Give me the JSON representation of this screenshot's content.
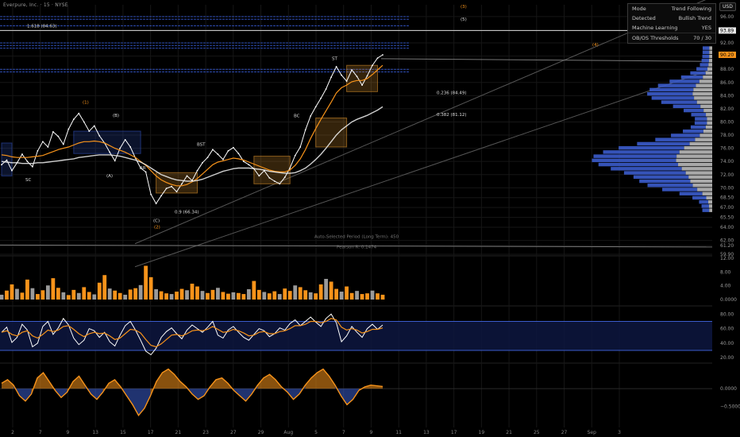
{
  "header": {
    "title": "Everpure, Inc. · 15 · NYSE",
    "currency": "USD"
  },
  "info_table": [
    {
      "label": "Mode",
      "value": "Trend Following"
    },
    {
      "label": "Detected",
      "value": "Bullish Trend"
    },
    {
      "label": "Machine Learning",
      "value": "YES"
    },
    {
      "label": "OB/OS Thresholds",
      "value": "70 / 30"
    }
  ],
  "colors": {
    "background": "#000000",
    "price": "#ffffff",
    "orange": "#f7931a",
    "blue": "#3b5ccc",
    "grid": "#161616",
    "label_current": "#f7931a"
  },
  "chart_data": [
    {
      "type": "line",
      "panel": "price",
      "ylim": [
        59.9,
        97.8
      ],
      "y_ticks": [
        96.0,
        93.89,
        92.0,
        90.0,
        88.0,
        86.0,
        84.0,
        82.0,
        80.0,
        78.0,
        76.0,
        74.0,
        72.0,
        70.0,
        68.5,
        67.0,
        65.5,
        64.0,
        62.0,
        61.2,
        59.9
      ],
      "y_tick_labels": [
        "96.00",
        "93.89",
        "92.00",
        "90.00",
        "88.00",
        "86.00",
        "84.00",
        "82.00",
        "80.00",
        "78.00",
        "76.00",
        "74.00",
        "72.00",
        "70.00",
        "68.50",
        "67.00",
        "65.50",
        "64.00",
        "62.00",
        "61.20",
        "59.90"
      ],
      "current_price_label": "90.20",
      "highlight_label": "93.89",
      "x_ticks": [
        "2",
        "7",
        "9",
        "13",
        "15",
        "17",
        "21",
        "23",
        "27",
        "29",
        "Aug",
        "5",
        "7",
        "9",
        "11",
        "13",
        "17",
        "19",
        "21",
        "25",
        "27",
        "Sep",
        "3"
      ],
      "series": [
        {
          "values": [
            73.5,
            74.2,
            72.6,
            73.8,
            75.1,
            74.0,
            73.2,
            75.6,
            77.0,
            76.2,
            78.5,
            77.8,
            76.6,
            78.9,
            80.4,
            81.3,
            80.0,
            78.6,
            79.4,
            77.9,
            76.8,
            75.4,
            74.1,
            76.0,
            77.3,
            76.2,
            74.5,
            73.0,
            72.4,
            69.0,
            67.6,
            68.8,
            69.9,
            70.2,
            69.4,
            70.6,
            71.8,
            71.1,
            72.6,
            73.8,
            74.6,
            75.8,
            75.1,
            74.3,
            75.6,
            76.1,
            75.2,
            74.0,
            73.5,
            72.9,
            71.8,
            72.6,
            71.5,
            71.0,
            70.6,
            71.6,
            73.0,
            74.9,
            76.2,
            78.8,
            80.9,
            82.3,
            83.6,
            85.0,
            86.8,
            88.4,
            87.1,
            86.2,
            87.9,
            86.9,
            85.6,
            87.0,
            88.6,
            89.7,
            90.2
          ]
        },
        {
          "values": [
            75.0,
            74.9,
            74.7,
            74.6,
            74.6,
            74.6,
            74.7,
            74.8,
            74.9,
            75.2,
            75.5,
            75.8,
            76.0,
            76.2,
            76.5,
            76.8,
            77.0,
            77.0,
            77.1,
            77.0,
            76.8,
            76.4,
            76.0,
            75.7,
            75.4,
            75.0,
            74.6,
            74.0,
            73.4,
            72.6,
            71.8,
            71.2,
            70.8,
            70.5,
            70.3,
            70.3,
            70.5,
            70.9,
            71.4,
            72.1,
            72.8,
            73.5,
            73.9,
            74.1,
            74.3,
            74.5,
            74.4,
            74.2,
            73.9,
            73.6,
            73.3,
            73.0,
            72.7,
            72.5,
            72.4,
            72.4,
            72.7,
            73.4,
            74.4,
            75.8,
            77.5,
            79.0,
            80.4,
            81.7,
            83.0,
            84.4,
            85.2,
            85.6,
            86.1,
            86.3,
            86.3,
            86.6,
            87.2,
            87.9,
            88.6
          ]
        },
        {
          "values": [
            74.0,
            73.9,
            73.8,
            73.8,
            73.7,
            73.7,
            73.7,
            73.8,
            73.8,
            73.9,
            74.0,
            74.1,
            74.2,
            74.3,
            74.4,
            74.6,
            74.7,
            74.8,
            74.9,
            75.0,
            75.0,
            75.0,
            74.9,
            74.8,
            74.6,
            74.4,
            74.2,
            73.9,
            73.5,
            73.0,
            72.5,
            72.0,
            71.7,
            71.4,
            71.2,
            71.1,
            71.0,
            71.0,
            71.1,
            71.3,
            71.6,
            71.9,
            72.2,
            72.5,
            72.7,
            72.9,
            73.0,
            73.0,
            73.0,
            72.9,
            72.8,
            72.7,
            72.5,
            72.4,
            72.3,
            72.2,
            72.2,
            72.3,
            72.6,
            73.0,
            73.6,
            74.3,
            75.1,
            76.0,
            77.0,
            78.0,
            78.8,
            79.4,
            80.0,
            80.4,
            80.7,
            81.0,
            81.4,
            81.8,
            82.3
          ]
        }
      ],
      "annotations": [
        "1.618 (84.63)",
        "0.236 (84.49)",
        "0.382 (81.12)",
        "0.9 (66.34)",
        "(1)",
        "(2)",
        "(3)",
        "(4)",
        "(5)",
        "(A)",
        "(B)",
        "(C)",
        "ST",
        "SC",
        "AR",
        "BC",
        "BST",
        "Auto-Selected Period (Long Term): 450",
        "Pearson R: 0.1474"
      ]
    },
    {
      "type": "bar",
      "panel": "volume",
      "ylim": [
        0,
        12
      ],
      "y_ticks": [
        0,
        4,
        8,
        12
      ],
      "y_tick_labels": [
        "0.0000",
        "4.00",
        "8.00",
        "12.00"
      ],
      "values": [
        1.4,
        2.6,
        4.4,
        3.1,
        2.0,
        5.8,
        3.3,
        1.6,
        2.7,
        4.1,
        6.2,
        3.4,
        2.1,
        1.3,
        2.8,
        1.9,
        3.6,
        2.2,
        1.5,
        4.9,
        7.1,
        3.2,
        2.6,
        1.9,
        1.4,
        2.9,
        3.3,
        4.2,
        9.8,
        6.5,
        3.0,
        2.4,
        1.8,
        1.6,
        2.3,
        3.1,
        2.7,
        4.6,
        3.8,
        2.5,
        1.9,
        2.8,
        3.4,
        2.2,
        1.7,
        2.1,
        1.9,
        1.6,
        3.0,
        5.4,
        2.8,
        2.2,
        1.8,
        2.4,
        1.6,
        3.2,
        2.5,
        4.1,
        3.6,
        2.7,
        2.1,
        1.8,
        4.4,
        6.0,
        5.2,
        3.1,
        2.3,
        3.8,
        1.9,
        2.5,
        1.6,
        1.8,
        2.6,
        1.8,
        1.4
      ]
    },
    {
      "type": "line",
      "panel": "oscillator",
      "ylim": [
        18,
        88
      ],
      "y_ticks": [
        20,
        40,
        60,
        80
      ],
      "y_tick_labels": [
        "20.00",
        "40.00",
        "60.00",
        "80.00"
      ],
      "bands": [
        30,
        70
      ],
      "series": [
        {
          "values": [
            55,
            62,
            41,
            48,
            66,
            58,
            35,
            40,
            63,
            70,
            52,
            61,
            74,
            65,
            47,
            38,
            44,
            60,
            57,
            48,
            55,
            42,
            36,
            51,
            64,
            70,
            58,
            44,
            29,
            24,
            33,
            48,
            56,
            61,
            53,
            46,
            58,
            65,
            60,
            55,
            62,
            70,
            51,
            47,
            58,
            63,
            55,
            48,
            44,
            52,
            60,
            57,
            49,
            53,
            61,
            58,
            67,
            72,
            64,
            70,
            76,
            69,
            63,
            74,
            80,
            68,
            42,
            50,
            63,
            55,
            48,
            60,
            66,
            59,
            65
          ]
        },
        {
          "values": [
            55,
            57,
            52,
            50,
            55,
            57,
            50,
            47,
            52,
            58,
            56,
            58,
            63,
            64,
            59,
            53,
            49,
            53,
            55,
            53,
            54,
            50,
            45,
            47,
            53,
            59,
            58,
            54,
            45,
            37,
            35,
            39,
            45,
            51,
            52,
            50,
            53,
            57,
            58,
            57,
            59,
            63,
            59,
            55,
            56,
            59,
            57,
            54,
            50,
            51,
            55,
            56,
            53,
            53,
            56,
            57,
            60,
            64,
            64,
            66,
            70,
            70,
            68,
            70,
            74,
            72,
            62,
            58,
            60,
            58,
            54,
            56,
            59,
            59,
            61
          ]
        }
      ]
    },
    {
      "type": "area",
      "panel": "momentum",
      "ylim": [
        -0.8,
        0.65
      ],
      "y_ticks": [
        0,
        -0.5
      ],
      "y_tick_labels": [
        "0.0000",
        "−0.5000"
      ],
      "values": [
        0.15,
        0.25,
        0.1,
        -0.2,
        -0.35,
        -0.15,
        0.3,
        0.45,
        0.2,
        -0.05,
        -0.25,
        -0.1,
        0.2,
        0.35,
        0.1,
        -0.15,
        -0.3,
        -0.1,
        0.15,
        0.25,
        0.05,
        -0.2,
        -0.45,
        -0.75,
        -0.55,
        -0.2,
        0.2,
        0.45,
        0.55,
        0.4,
        0.2,
        0.05,
        -0.15,
        -0.3,
        -0.2,
        0.05,
        0.25,
        0.3,
        0.15,
        -0.05,
        -0.2,
        -0.35,
        -0.15,
        0.1,
        0.3,
        0.4,
        0.25,
        0.05,
        -0.1,
        -0.3,
        -0.15,
        0.1,
        0.3,
        0.45,
        0.55,
        0.35,
        0.1,
        -0.2,
        -0.45,
        -0.3,
        -0.05,
        0.05,
        0.1,
        0.08,
        0.06
      ]
    }
  ]
}
